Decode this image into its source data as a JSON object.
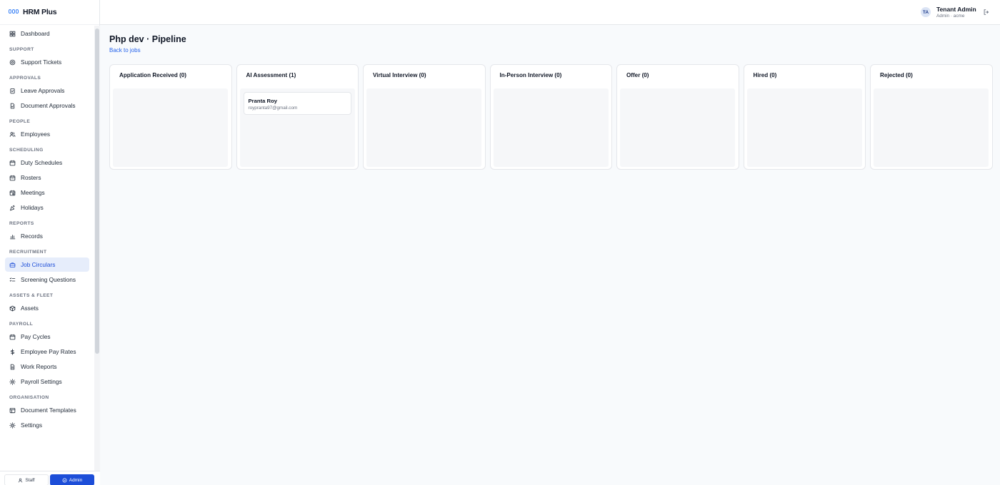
{
  "brand": {
    "name": "HRM Plus"
  },
  "sidebar": {
    "top_items": [
      {
        "label": "Dashboard",
        "icon": "dashboard-icon"
      }
    ],
    "sections": [
      {
        "title": "SUPPORT",
        "items": [
          {
            "label": "Support Tickets",
            "icon": "lifebuoy-icon"
          }
        ]
      },
      {
        "title": "APPROVALS",
        "items": [
          {
            "label": "Leave Approvals",
            "icon": "clipboard-check-icon"
          },
          {
            "label": "Document Approvals",
            "icon": "document-check-icon"
          }
        ]
      },
      {
        "title": "PEOPLE",
        "items": [
          {
            "label": "Employees",
            "icon": "users-icon"
          }
        ]
      },
      {
        "title": "SCHEDULING",
        "items": [
          {
            "label": "Duty Schedules",
            "icon": "calendar-icon"
          },
          {
            "label": "Rosters",
            "icon": "calendar-grid-icon"
          },
          {
            "label": "Meetings",
            "icon": "calendar-clock-icon"
          },
          {
            "label": "Holidays",
            "icon": "party-icon"
          }
        ]
      },
      {
        "title": "REPORTS",
        "items": [
          {
            "label": "Records",
            "icon": "bar-chart-icon"
          }
        ]
      },
      {
        "title": "RECRUITMENT",
        "items": [
          {
            "label": "Job Circulars",
            "icon": "briefcase-icon",
            "active": true
          },
          {
            "label": "Screening Questions",
            "icon": "list-check-icon"
          }
        ]
      },
      {
        "title": "ASSETS & FLEET",
        "items": [
          {
            "label": "Assets",
            "icon": "package-icon"
          }
        ]
      },
      {
        "title": "PAYROLL",
        "items": [
          {
            "label": "Pay Cycles",
            "icon": "calendar-icon"
          },
          {
            "label": "Employee Pay Rates",
            "icon": "dollar-icon"
          },
          {
            "label": "Work Reports",
            "icon": "document-icon"
          },
          {
            "label": "Payroll Settings",
            "icon": "gear-icon"
          }
        ]
      },
      {
        "title": "ORGANISATION",
        "items": [
          {
            "label": "Document Templates",
            "icon": "template-icon"
          },
          {
            "label": "Settings",
            "icon": "gear-icon"
          }
        ]
      }
    ]
  },
  "mode_switch": {
    "staff_label": "Staff",
    "admin_label": "Admin",
    "active": "admin"
  },
  "user": {
    "initials": "TA",
    "name": "Tenant Admin",
    "role": "Admin · acme"
  },
  "page": {
    "title": "Php dev · Pipeline",
    "back_label": "Back to jobs"
  },
  "pipeline": {
    "columns": [
      {
        "title": "Application Received (0)",
        "cards": []
      },
      {
        "title": "AI Assessment (1)",
        "cards": [
          {
            "name": "Pranta Roy",
            "email": "roypranta97@gmail.com"
          }
        ]
      },
      {
        "title": "Virtual Interview (0)",
        "cards": []
      },
      {
        "title": "In-Person Interview (0)",
        "cards": []
      },
      {
        "title": "Offer (0)",
        "cards": []
      },
      {
        "title": "Hired (0)",
        "cards": []
      },
      {
        "title": "Rejected (0)",
        "cards": []
      }
    ]
  },
  "colors": {
    "accent": "#1d4ed8",
    "active_bg": "#e6edfb",
    "link": "#2563eb"
  }
}
